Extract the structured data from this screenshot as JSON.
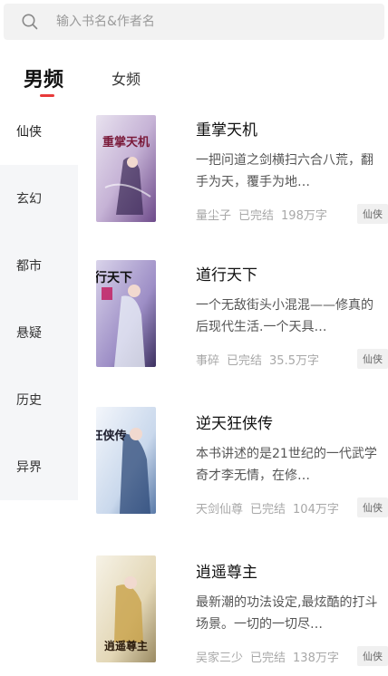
{
  "search": {
    "placeholder": "输入书名&作者名"
  },
  "gender_tabs": {
    "active": "男频",
    "inactive": "女频"
  },
  "sidebar": {
    "items": [
      {
        "label": "仙侠"
      },
      {
        "label": "玄幻"
      },
      {
        "label": "都市"
      },
      {
        "label": "悬疑"
      },
      {
        "label": "历史"
      },
      {
        "label": "异界"
      }
    ]
  },
  "books": [
    {
      "title": "重掌天机",
      "desc": "一把问道之剑横扫六合八荒，翻手为天，覆手为地…",
      "author": "量尘子",
      "status": "已完结",
      "words": "198万字",
      "tag": "仙侠",
      "cover_text": "重掌天机"
    },
    {
      "title": "道行天下",
      "desc": "一个无敌街头小混混——修真的后现代生活.一个天具…",
      "author": "事碎",
      "status": "已完结",
      "words": "35.5万字",
      "tag": "仙侠",
      "cover_text": "道行天下"
    },
    {
      "title": "逆天狂侠传",
      "desc": "本书讲述的是21世纪的一代武学奇才李无情，在修…",
      "author": "天剑仙尊",
      "status": "已完结",
      "words": "104万字",
      "tag": "仙侠",
      "cover_text": "狂侠传"
    },
    {
      "title": "逍遥尊主",
      "desc": "最新潮的功法设定,最炫酷的打斗场景。一切的一切尽…",
      "author": "吴家三少",
      "status": "已完结",
      "words": "138万字",
      "tag": "仙侠",
      "cover_text": "逍遥尊主"
    }
  ],
  "colors": {
    "accent": "#e83a3a",
    "sidebar_bg": "#f5f6f8"
  }
}
